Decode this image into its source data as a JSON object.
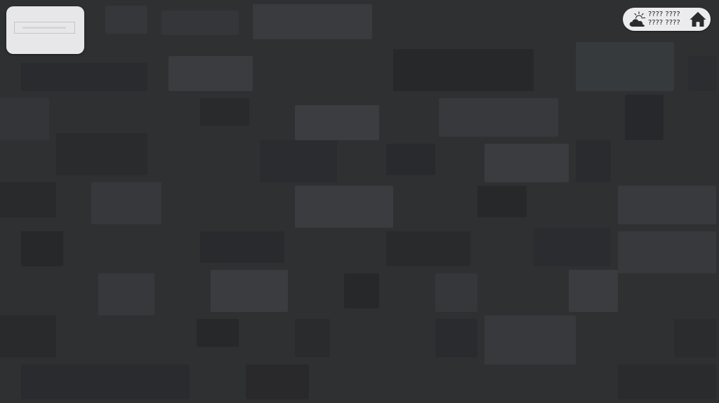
{
  "header": {
    "status_line_1": "???? ????",
    "status_line_2": "???? ????"
  },
  "icons": {
    "weather": "partly-cloudy-icon",
    "home": "home-icon"
  },
  "colors": {
    "background": "#2f3032",
    "card": "#e7e6e9",
    "pill": "#ececee",
    "icon": "#2a2b2e"
  }
}
